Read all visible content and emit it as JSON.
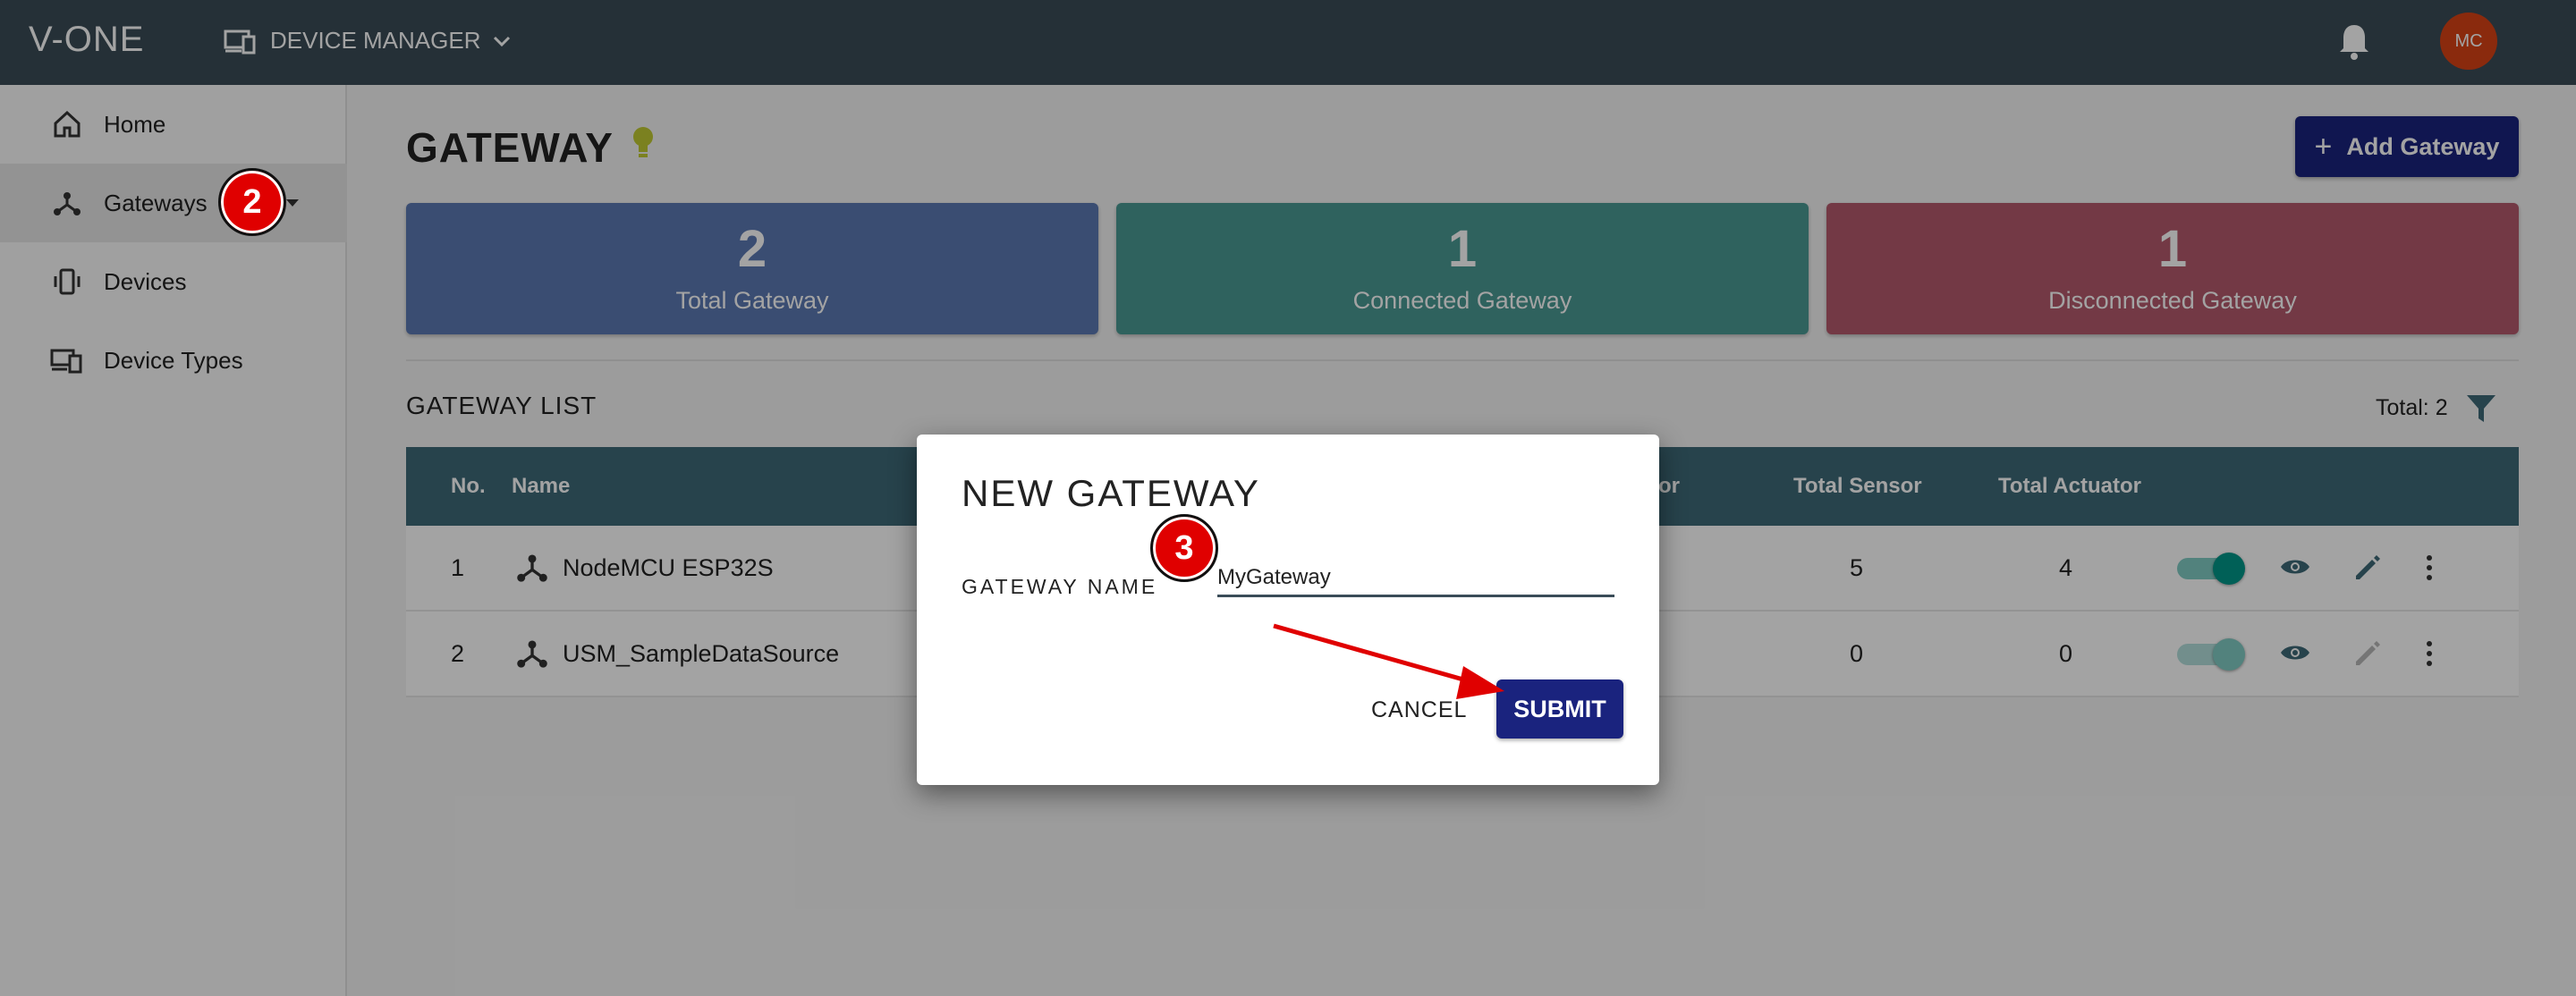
{
  "topbar": {
    "logo": "V-ONE",
    "module": "DEVICE MANAGER",
    "avatar_initials": "MC"
  },
  "sidebar": {
    "items": [
      {
        "label": "Home",
        "icon": "home-icon"
      },
      {
        "label": "Gateways",
        "icon": "gateway-icon",
        "active": true
      },
      {
        "label": "Devices",
        "icon": "device-icon"
      },
      {
        "label": "Device Types",
        "icon": "device-types-icon"
      }
    ]
  },
  "page": {
    "title": "GATEWAY",
    "add_button": "Add Gateway"
  },
  "stats": [
    {
      "value": "2",
      "label": "Total Gateway",
      "color": "#5b79b3"
    },
    {
      "value": "1",
      "label": "Connected Gateway",
      "color": "#4a9994"
    },
    {
      "value": "1",
      "label": "Disconnected Gateway",
      "color": "#b55a6c"
    }
  ],
  "list": {
    "title": "GATEWAY LIST",
    "total": "Total: 2",
    "headers": {
      "no": "No.",
      "name": "Name",
      "partial": "or",
      "total_sensor": "Total Sensor",
      "total_actuator": "Total Actuator"
    },
    "rows": [
      {
        "no": "1",
        "name": "NodeMCU ESP32S",
        "sensor": "5",
        "actuator": "4",
        "enabled": true
      },
      {
        "no": "2",
        "name": "USM_SampleDataSource",
        "sensor": "0",
        "actuator": "0",
        "enabled": true
      }
    ]
  },
  "dialog": {
    "title": "NEW GATEWAY",
    "field_label": "GATEWAY NAME",
    "field_value": "MyGateway",
    "cancel": "CANCEL",
    "submit": "SUBMIT"
  },
  "annotations": {
    "step_2": "2",
    "step_3": "3",
    "color": "#e00000"
  }
}
